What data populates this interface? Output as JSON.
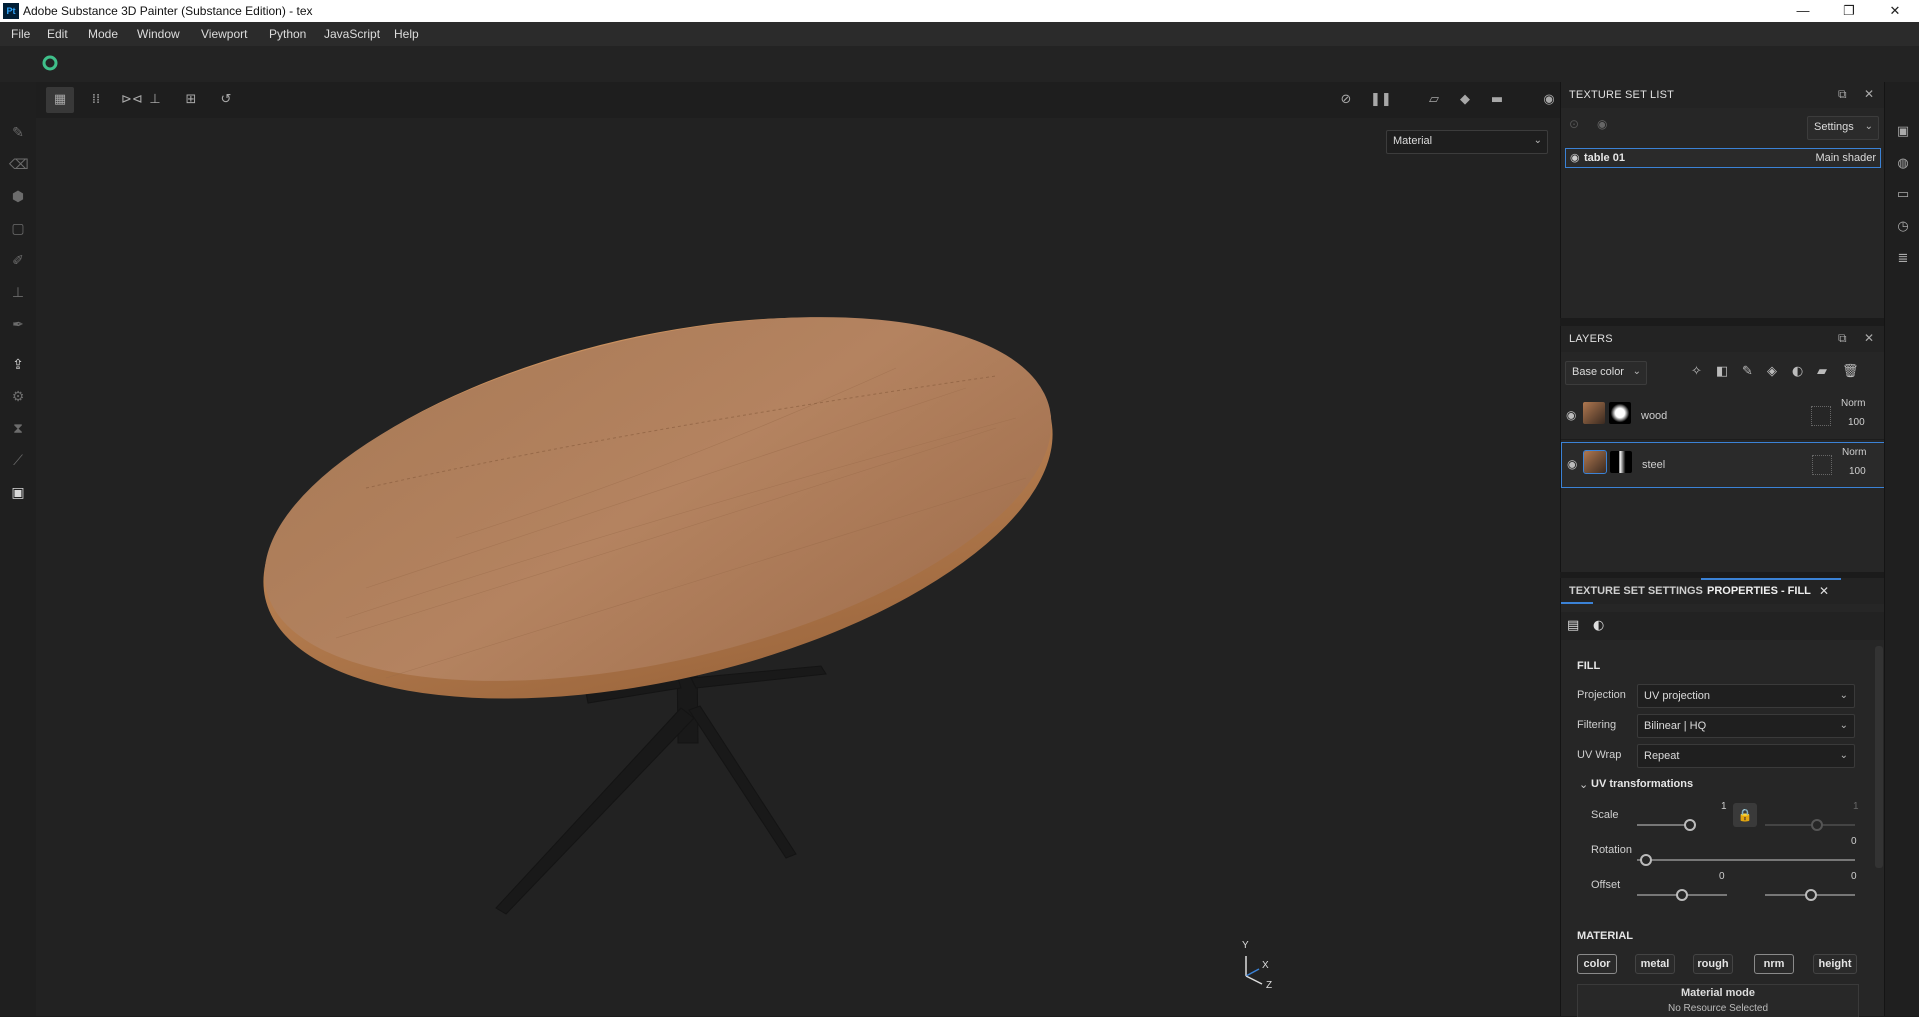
{
  "window": {
    "app_badge": "Pt",
    "title": "Adobe Substance 3D Painter (Substance Edition) - tex",
    "minimize": "—",
    "maximize": "❐",
    "close": "✕"
  },
  "menu": [
    "File",
    "Edit",
    "Mode",
    "Window",
    "Viewport",
    "Python",
    "JavaScript",
    "Help"
  ],
  "viewport": {
    "mode_dropdown": "Material",
    "axis_labels": {
      "y": "Y",
      "x": "X",
      "z": "Z"
    }
  },
  "texture_set_list": {
    "title": "TEXTURE SET LIST",
    "settings_label": "Settings",
    "items": [
      {
        "name": "table 01",
        "shader": "Main shader"
      }
    ]
  },
  "layers": {
    "title": "LAYERS",
    "channel_dropdown": "Base color",
    "items": [
      {
        "name": "wood",
        "blend": "Norm",
        "opacity": "100"
      },
      {
        "name": "steel",
        "blend": "Norm",
        "opacity": "100"
      }
    ]
  },
  "properties": {
    "tab_texture_set_settings": "TEXTURE SET SETTINGS",
    "tab_properties_fill": "PROPERTIES - FILL",
    "section_fill": "FILL",
    "projection_label": "Projection",
    "projection_value": "UV projection",
    "filtering_label": "Filtering",
    "filtering_value": "Bilinear | HQ",
    "uvwrap_label": "UV Wrap",
    "uvwrap_value": "Repeat",
    "uv_transformations": "UV transformations",
    "scale_label": "Scale",
    "scale_value": "1",
    "scale_value_2": "1",
    "rotation_label": "Rotation",
    "rotation_value": "0",
    "offset_label": "Offset",
    "offset_x": "0",
    "offset_y": "0",
    "section_material": "MATERIAL",
    "channels": [
      "color",
      "metal",
      "rough",
      "nrm",
      "height"
    ],
    "material_mode_label": "Material mode",
    "material_mode_value": "No Resource Selected"
  },
  "colors": {
    "accent": "#3b82d6",
    "wood": "#b07850",
    "steel": "#1c1c1c"
  }
}
